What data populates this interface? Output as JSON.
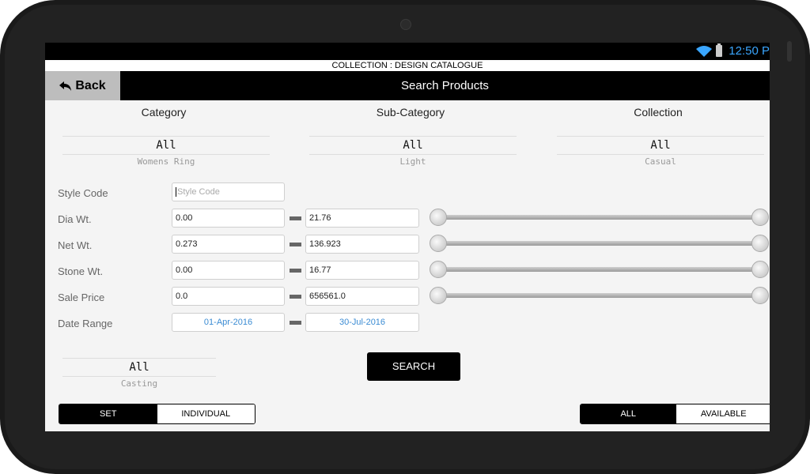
{
  "status": {
    "time": "12:50 P"
  },
  "collection_bar": "COLLECTION : DESIGN CATALOGUE",
  "header": {
    "back_label": "Back",
    "title": "Search Products"
  },
  "columns": [
    {
      "title": "Category",
      "selected": "All",
      "sub": "Womens Ring"
    },
    {
      "title": "Sub-Category",
      "selected": "All",
      "sub": "Light"
    },
    {
      "title": "Collection",
      "selected": "All",
      "sub": "Casual"
    }
  ],
  "form": {
    "style_code": {
      "label": "Style Code",
      "placeholder": "Style Code"
    },
    "dia_wt": {
      "label": "Dia Wt.",
      "min": "0.00",
      "max": "21.76"
    },
    "net_wt": {
      "label": "Net Wt.",
      "min": "0.273",
      "max": "136.923"
    },
    "stone_wt": {
      "label": "Stone Wt.",
      "min": "0.00",
      "max": "16.77"
    },
    "sale_price": {
      "label": "Sale Price",
      "min": "0.0",
      "max": "656561.0"
    },
    "date_range": {
      "label": "Date Range",
      "from": "01-Apr-2016",
      "to": "30-Jul-2016"
    }
  },
  "search_label": "SEARCH",
  "casting": {
    "selected": "All",
    "sub": "Casting"
  },
  "set_toggle": {
    "left": "SET",
    "right": "INDIVIDUAL",
    "active": "SET"
  },
  "stock_toggle": {
    "left": "ALL",
    "right": "AVAILABLE",
    "active": "ALL"
  }
}
